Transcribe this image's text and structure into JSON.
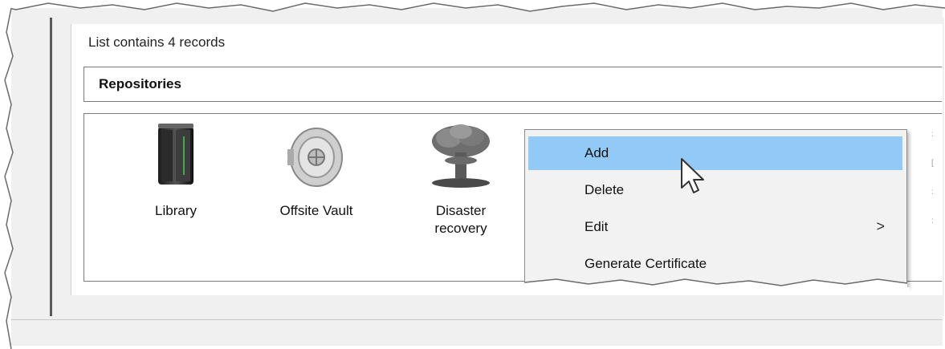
{
  "status": {
    "record_count_text": "List contains 4 records"
  },
  "section": {
    "title": "Repositories"
  },
  "repositories": [
    {
      "label": "Library",
      "icon": "server-rack-icon"
    },
    {
      "label": "Offsite Vault",
      "icon": "vault-door-icon"
    },
    {
      "label_line1": "Disaster",
      "label_line2": "recovery",
      "icon": "mushroom-cloud-icon"
    }
  ],
  "context_menu": {
    "items": [
      {
        "label": "Add",
        "highlighted": true
      },
      {
        "label": "Delete"
      },
      {
        "label": "Edit",
        "submenu_indicator": ">"
      },
      {
        "label": "Generate Certificate"
      }
    ]
  },
  "colors": {
    "menu_highlight": "#91c9f7",
    "window_bg": "#f0f0f0"
  }
}
